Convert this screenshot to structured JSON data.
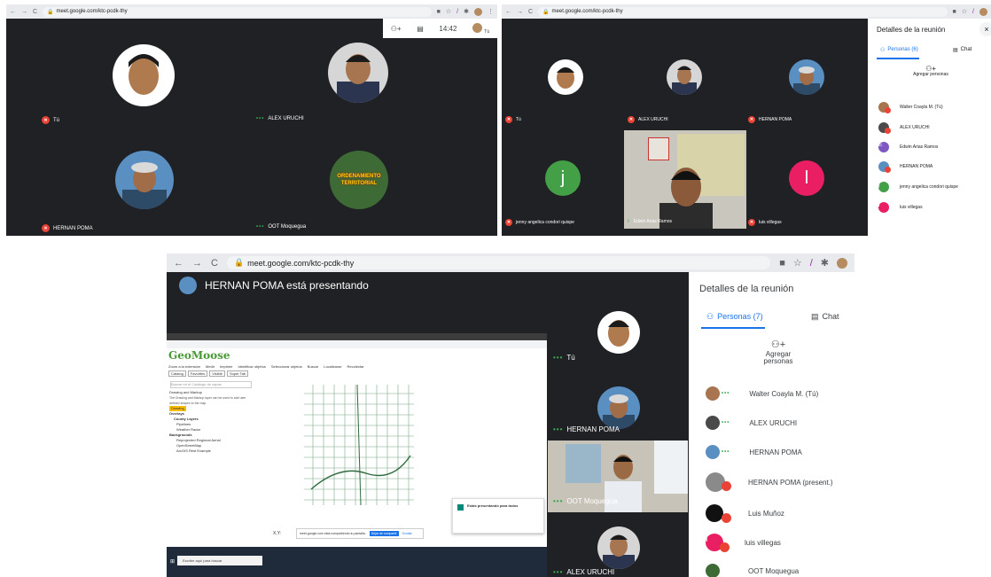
{
  "shot1": {
    "url": "meet.google.com/ktc-pcdk-thy",
    "clock": "14:42",
    "you_label": "Tú",
    "participants": [
      {
        "name": "Tú",
        "status": "muted"
      },
      {
        "name": "ALEX URUCHI",
        "status": "talking"
      },
      {
        "name": "HERNAN POMA",
        "status": "muted"
      },
      {
        "name": "OOT Moquegua",
        "status": "talking"
      }
    ],
    "logo_text": "ORDENAMIENTO TERRITORIAL"
  },
  "shot2": {
    "url": "meet.google.com/ktc-pcdk-thy",
    "panel_title": "Detalles de la reunión",
    "tab_people": "Personas (6)",
    "tab_chat": "Chat",
    "add_people": "Agregar personas",
    "tiles": [
      {
        "name": "Tú",
        "status": "muted"
      },
      {
        "name": "ALEX URUCHI",
        "status": "muted"
      },
      {
        "name": "HERNAN POMA",
        "status": "muted"
      },
      {
        "name": "jenny angelica condori quispe",
        "status": "muted",
        "letter": "j",
        "color": "#43a047"
      },
      {
        "name": "Edwin Arias Ramos",
        "status": "talking"
      },
      {
        "name": "luis villegas",
        "status": "muted",
        "letter": "l",
        "color": "#e91e63"
      }
    ],
    "people": [
      {
        "name": "Walter Coayla M. (Tú)"
      },
      {
        "name": "ALEX URUCHI"
      },
      {
        "name": "Edwin Arias Ramos",
        "letter": "E",
        "color": "#7e57c2"
      },
      {
        "name": "HERNAN POMA"
      },
      {
        "name": "jenny angelica condori quispe",
        "letter": "j",
        "color": "#43a047"
      },
      {
        "name": "luis villegas",
        "letter": "l",
        "color": "#e91e63"
      }
    ]
  },
  "shot3": {
    "url": "meet.google.com/ktc-pcdk-thy",
    "presenting": "HERNAN POMA está presentando",
    "panel_title": "Detalles de la reunión",
    "tab_people": "Personas (7)",
    "tab_chat": "Chat",
    "add_people": "Agregar personas",
    "app_name": "GeoMoose",
    "toolbar": [
      "Zoom a la extensión",
      "Medir",
      "Imprimir",
      "Identificar objetos",
      "Seleccionar objetos",
      "Buscar",
      "Localizarse",
      "Recolectar"
    ],
    "tabs": [
      "Catalog",
      "Favorites",
      "Visible",
      "Super Tab"
    ],
    "search_placeholder": "Buscar en el Catálogo de capas",
    "tree": [
      "Drawing and Markup",
      "The Drawing and Markup layer can be used to add user defined shapes to the map.",
      "Drawing",
      "Overlays",
      "County Layers",
      "Pipelines",
      "Weather Radar",
      "Backgrounds",
      "Reprojected Regional Aerial",
      "OpenStreetMap",
      "ArcGIS Rest Example"
    ],
    "sharing_title": "Estás presentando para todos",
    "share_bar_text": "meet.google.com está compartiendo tu pantalla.",
    "share_stop": "Dejar de compartir",
    "share_hide": "Ocultar",
    "coords_label": "X,Y:",
    "taskbar_search": "Escribe aquí para buscar",
    "tiles": [
      {
        "name": "Tú",
        "status": "talking"
      },
      {
        "name": "HERNAN POMA",
        "status": "talking"
      },
      {
        "name": "OOT Moquegua",
        "status": "talking"
      },
      {
        "name": "ALEX URUCHI",
        "status": "talking"
      }
    ],
    "people": [
      {
        "name": "Walter Coayla M. (Tú)",
        "status": "talking"
      },
      {
        "name": "ALEX URUCHI",
        "status": "talking"
      },
      {
        "name": "HERNAN POMA",
        "status": "talking"
      },
      {
        "name": "HERNAN POMA (present.)",
        "status": "muted"
      },
      {
        "name": "Luis Muñoz",
        "status": "muted"
      },
      {
        "name": "luis villegas",
        "status": "muted",
        "letter": "l",
        "color": "#e91e63"
      },
      {
        "name": "OOT Moquegua",
        "status": "talking"
      }
    ]
  }
}
